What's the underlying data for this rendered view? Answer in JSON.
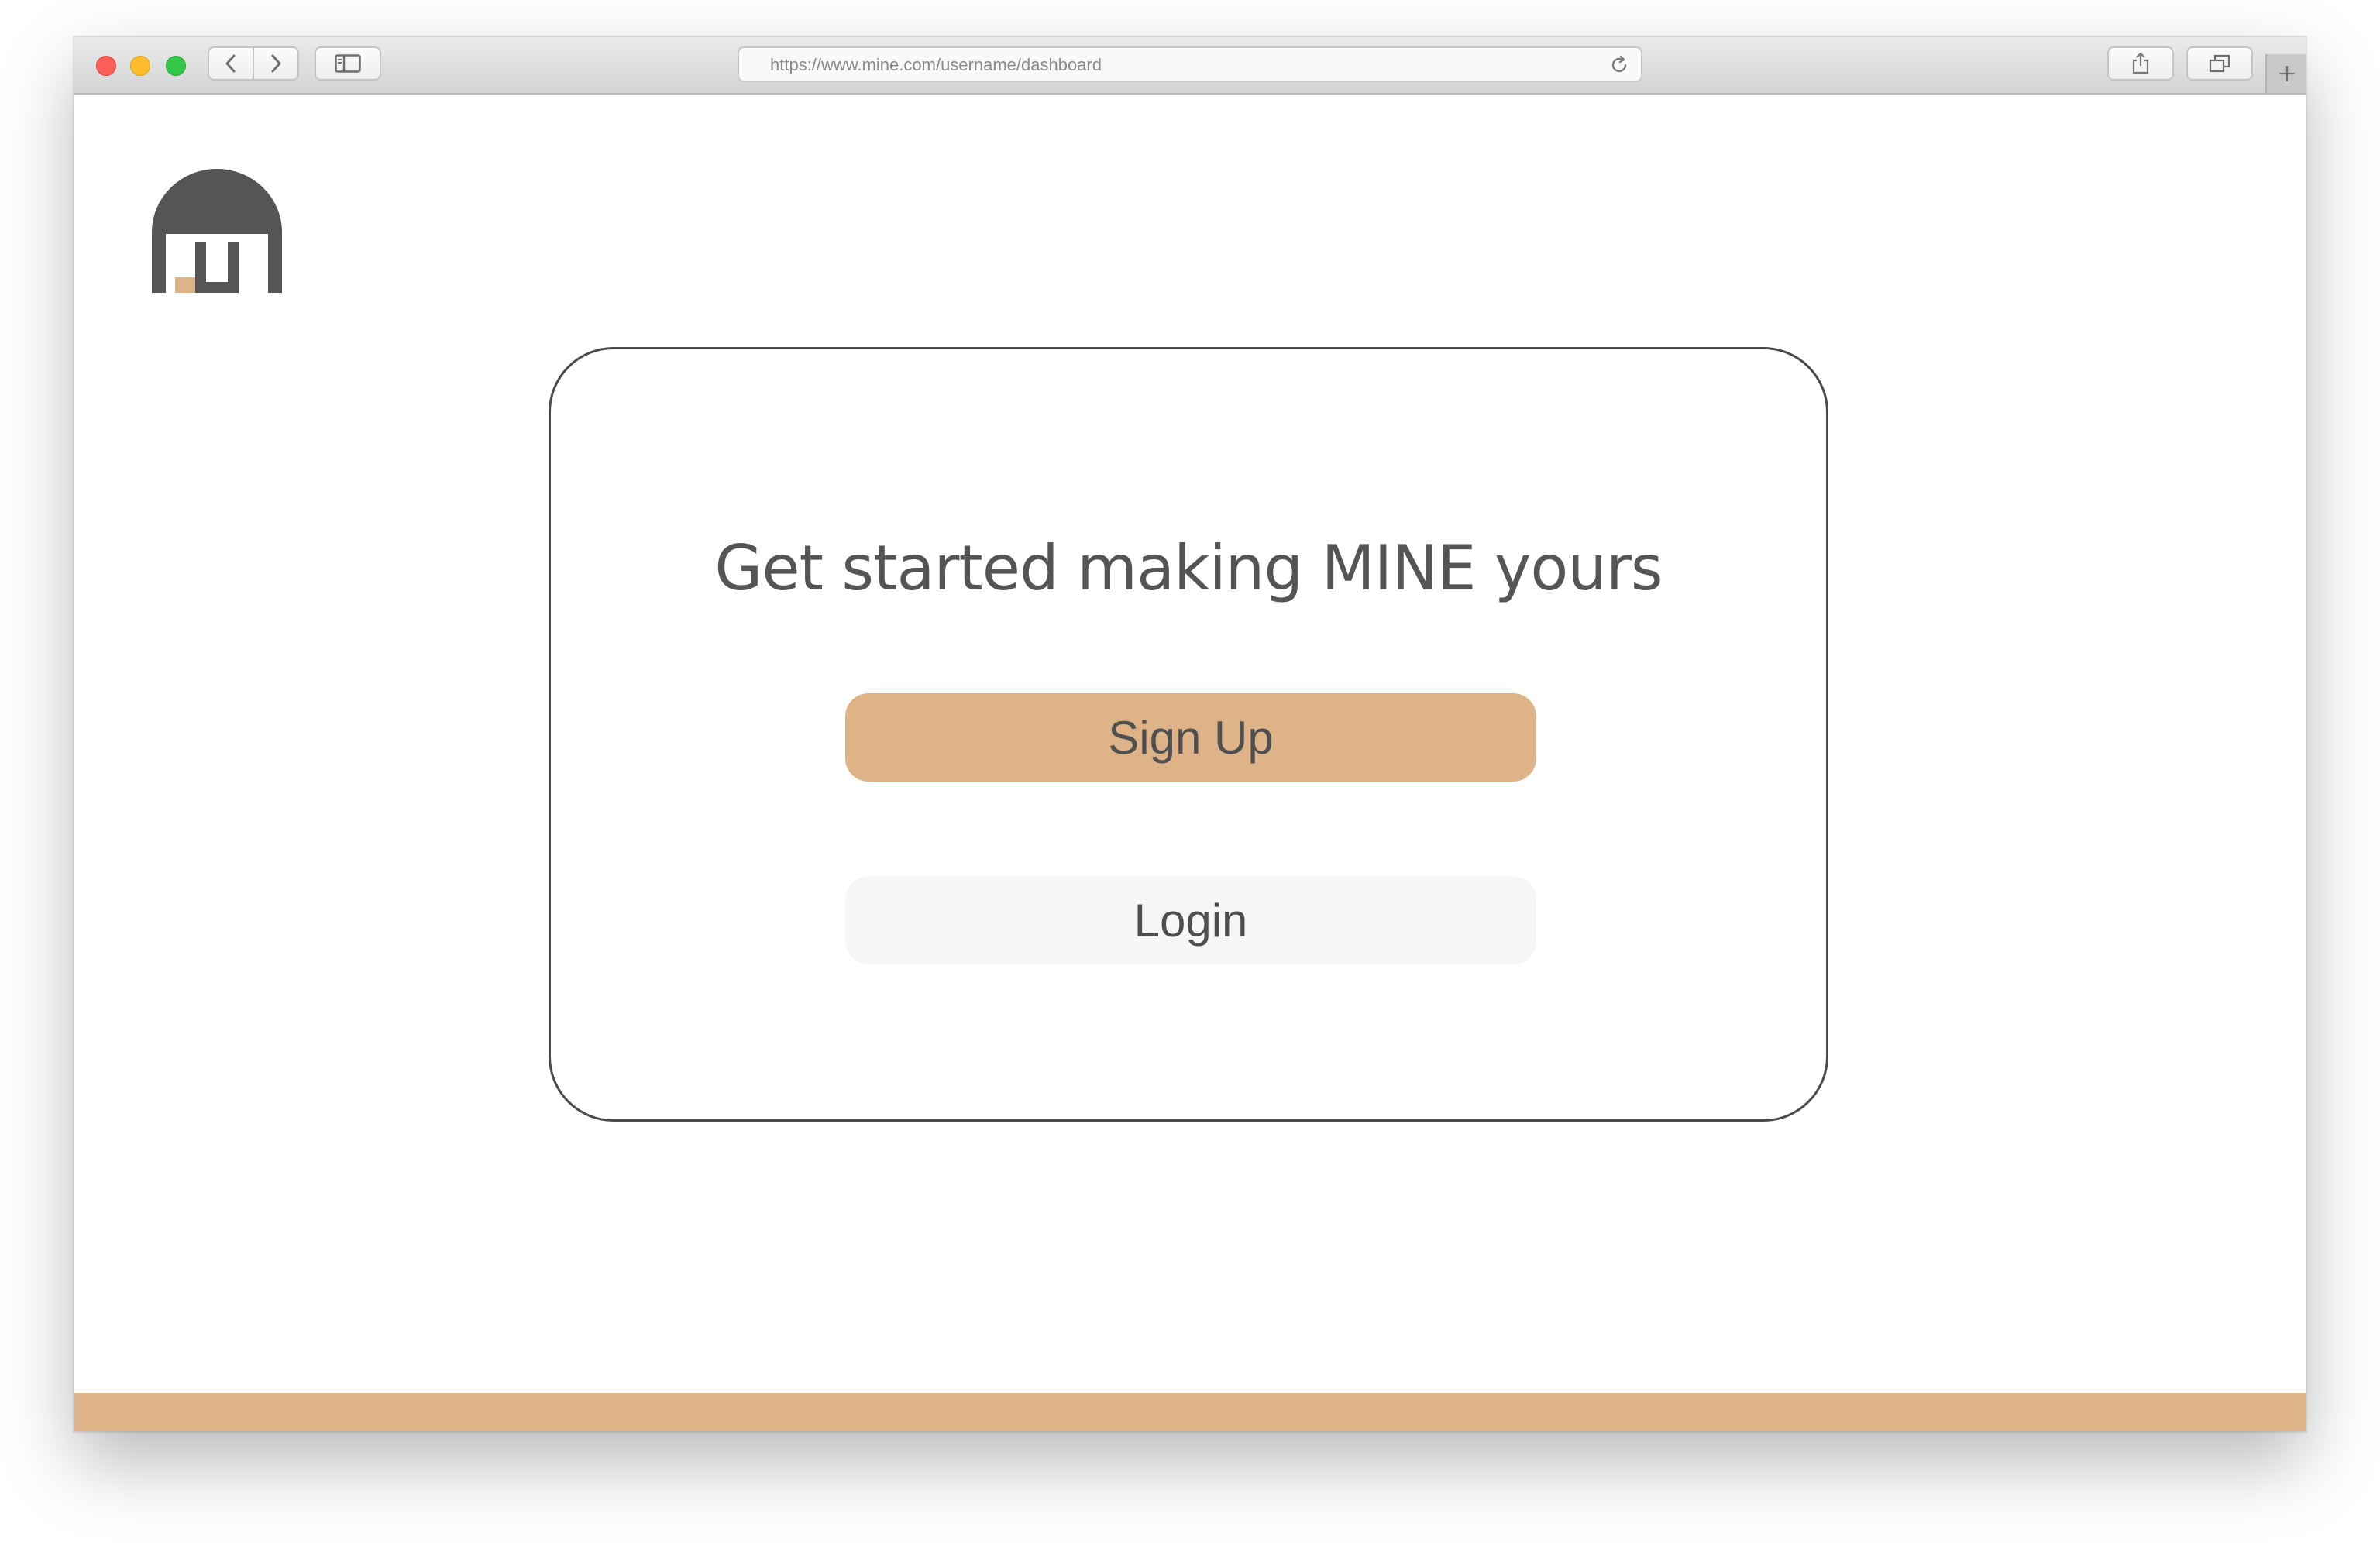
{
  "browser": {
    "url": "https://www.mine.com/username/dashboard",
    "icons": {
      "back": "chevron-left-icon",
      "forward": "chevron-right-icon",
      "sidebar": "sidebar-icon",
      "reload": "reload-icon",
      "share": "share-icon",
      "tabs": "tabs-icon",
      "new_tab": "plus-icon"
    }
  },
  "brand": {
    "logo": "mine-logo-icon",
    "dark_color": "#555555",
    "accent_color": "#ddb387"
  },
  "main": {
    "headline": "Get started making MINE yours",
    "signup_label": "Sign Up",
    "login_label": "Login"
  }
}
